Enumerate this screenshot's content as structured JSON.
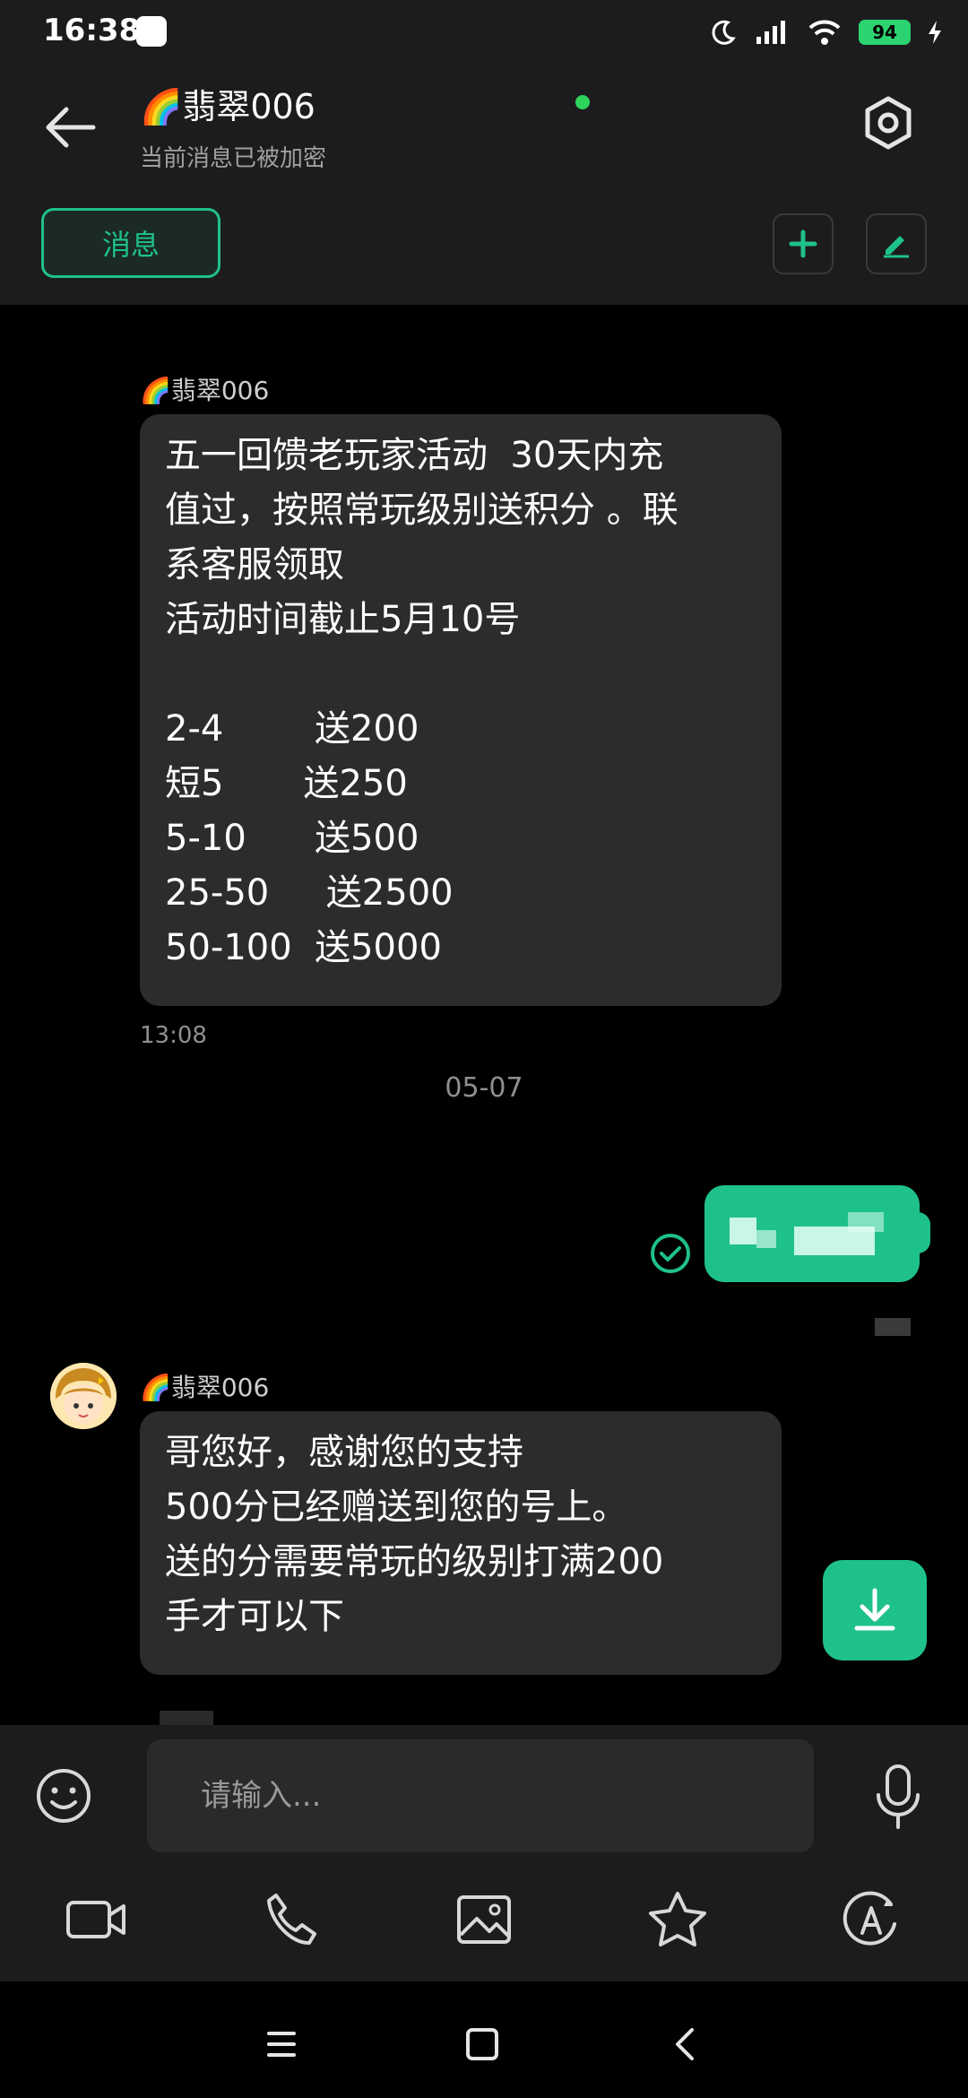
{
  "status_bar": {
    "time": "16:38",
    "battery": "94"
  },
  "header": {
    "title": "🌈翡翠006",
    "subtitle": "当前消息已被加密",
    "tab_label": "消息"
  },
  "messages": [
    {
      "sender": "🌈翡翠006",
      "text": "五一回馈老玩家活动  30天内充\n值过，按照常玩级别送积分 。联\n系客服领取\n活动时间截止5月10号\n\n2-4        送200\n短5       送250\n5-10      送500\n25-50     送2500\n50-100  送5000",
      "time": "13:08"
    },
    {
      "date_separator": "05-07"
    },
    {
      "sender": "🌈翡翠006",
      "text": "哥您好，感谢您的支持\n500分已经赠送到您的号上。\n送的分需要常玩的级别打满200\n手才可以下"
    }
  ],
  "input": {
    "placeholder": "请输入..."
  },
  "colors": {
    "accent": "#1fc18b",
    "bubble": "#2c2c2e",
    "background": "#000000",
    "header": "#1c1c1e"
  },
  "icons": [
    "back-arrow-icon",
    "settings-hexagon-icon",
    "plus-icon",
    "edit-icon",
    "check-circle-icon",
    "download-icon",
    "emoji-icon",
    "mic-icon",
    "video-icon",
    "phone-icon",
    "image-icon",
    "star-icon",
    "text-a-icon",
    "menu-icon",
    "home-square-icon",
    "back-chevron-icon"
  ]
}
